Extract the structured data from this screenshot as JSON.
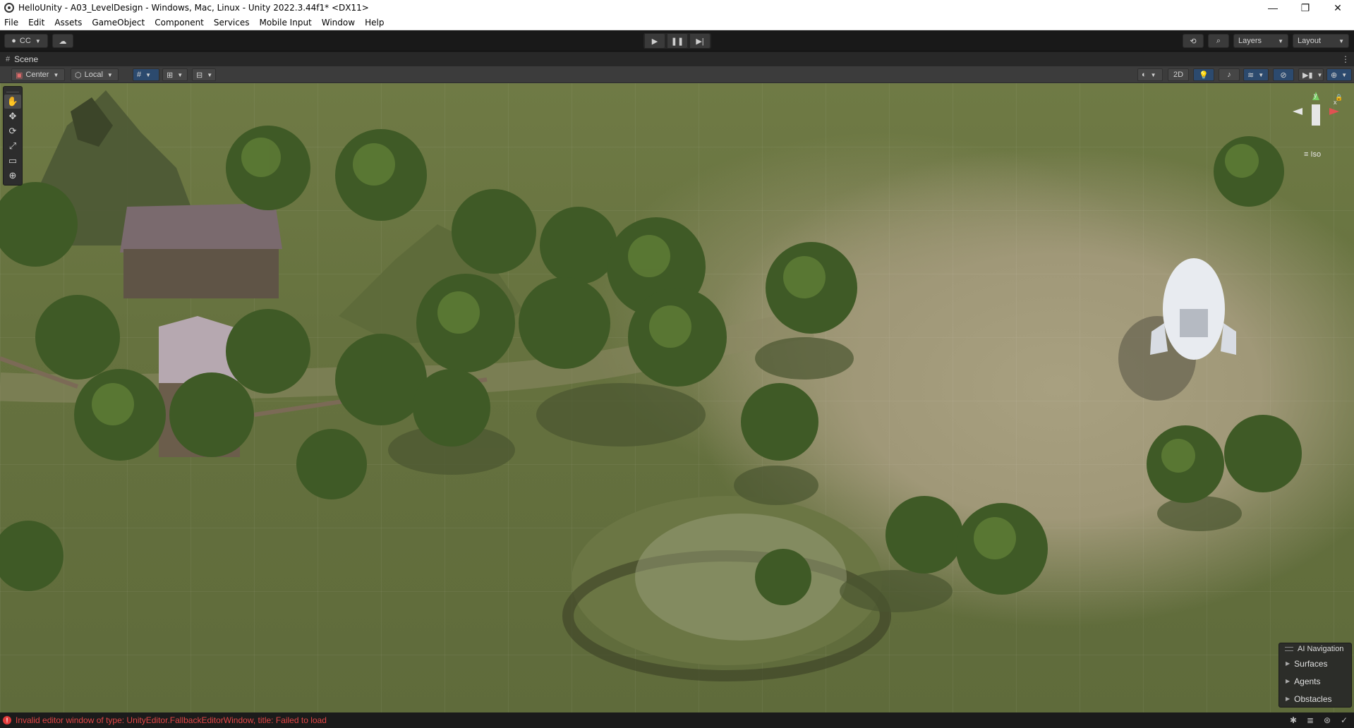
{
  "window": {
    "title": "HelloUnity - A03_LevelDesign - Windows, Mac, Linux - Unity 2022.3.44f1* <DX11>",
    "minimize": "—",
    "restore": "❐",
    "close": "✕"
  },
  "menu": [
    "File",
    "Edit",
    "Assets",
    "GameObject",
    "Component",
    "Services",
    "Mobile Input",
    "Window",
    "Help"
  ],
  "toolbar": {
    "account_label": "CC",
    "layers_label": "Layers",
    "layout_label": "Layout"
  },
  "scene_tab": {
    "label": "Scene"
  },
  "scene_toolbar": {
    "pivot_label": "Center",
    "space_label": "Local",
    "mode_2d_label": "2D"
  },
  "gizmo": {
    "x": "x",
    "y": "y",
    "projection_label": "Iso"
  },
  "ai_navigation": {
    "title": "AI Navigation",
    "items": [
      "Surfaces",
      "Agents",
      "Obstacles"
    ]
  },
  "status": {
    "message": "Invalid editor window of type: UnityEditor.FallbackEditorWindow, title: Failed to load"
  },
  "colors": {
    "error": "#e24646",
    "toolbar_bg": "#191919",
    "scene_grass": "#6f7a45",
    "scene_sand": "#a8a080"
  }
}
